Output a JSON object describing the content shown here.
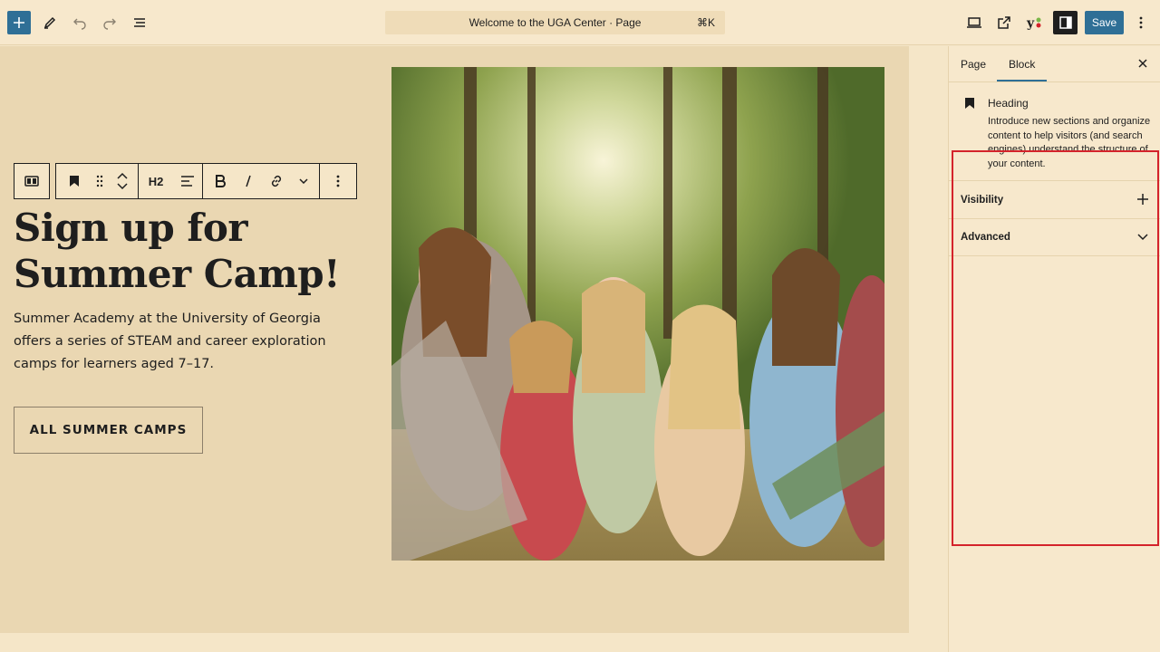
{
  "topbar": {
    "document_title": "Welcome to the UGA Center · Page",
    "shortcut": "⌘K",
    "save_label": "Save",
    "icons": [
      "plus-icon",
      "pencil-icon",
      "undo-icon",
      "redo-icon",
      "list-view-icon",
      "desktop-preview-icon",
      "external-link-icon",
      "yoast-icon",
      "settings-panel-icon",
      "more-options-icon"
    ]
  },
  "block_toolbar": {
    "heading_level": "H2"
  },
  "canvas": {
    "heading_line1": "Sign up for",
    "heading_line2": "Summer Camp!",
    "paragraph": "Summer Academy at the University of Georgia offers a series of STEAM and career exploration camps for learners aged 7–17.",
    "button_label": "ALL SUMMER CAMPS"
  },
  "sidebar": {
    "tabs": [
      {
        "label": "Page"
      },
      {
        "label": "Block"
      }
    ],
    "active_tab": "Block",
    "block_card": {
      "title": "Heading",
      "description": "Introduce new sections and organize content to help visitors (and search engines) understand the structure of your content."
    },
    "panels": [
      {
        "label": "Visibility",
        "icon": "plus-icon"
      },
      {
        "label": "Advanced",
        "icon": "chevron-down-icon"
      }
    ]
  },
  "colors": {
    "accent": "#2f6f96",
    "highlight": "#d4232b",
    "canvas_bg": "#ead7b2"
  }
}
